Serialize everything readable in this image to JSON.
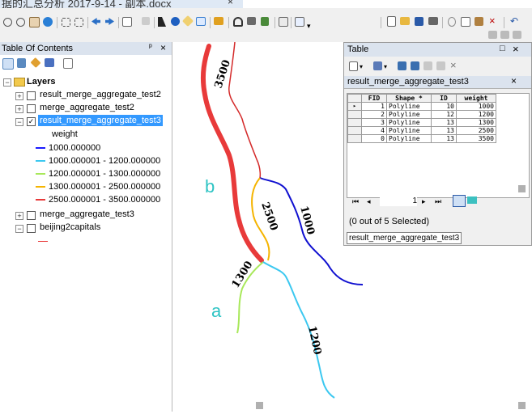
{
  "window": {
    "doc_tab_title": "据的汇总分析 2017-9-14 - 副本.docx",
    "doc_tab_close": "×"
  },
  "toc": {
    "title": "Table Of Contents",
    "pin": "ᵖ",
    "close": "×",
    "root_label": "Layers",
    "layers": [
      {
        "label": "result_merge_aggregate_test2",
        "expanded": false,
        "checked": false
      },
      {
        "label": "merge_aggregate_test2",
        "expanded": false,
        "checked": false
      },
      {
        "label": "result_merge_aggregate_test3",
        "expanded": true,
        "checked": true,
        "selected": true
      },
      {
        "label": "merge_aggregate_test3",
        "expanded": false,
        "checked": false
      },
      {
        "label": "beijing2capitals",
        "expanded": false,
        "checked": false
      }
    ],
    "field_label": "weight",
    "legend": [
      {
        "label": "1000.000000",
        "color": "#1a1aff"
      },
      {
        "label": "1000.000001 - 1200.000000",
        "color": "#3cc8f0"
      },
      {
        "label": "1200.000001 - 1300.000000",
        "color": "#a8e85a"
      },
      {
        "label": "1300.000001 - 2500.000000",
        "color": "#f5b400"
      },
      {
        "label": "2500.000001 - 3500.000000",
        "color": "#e83a3a"
      }
    ],
    "beijing_symbol_color": "#e83a3a"
  },
  "map": {
    "labels": {
      "a": "a",
      "b": "b",
      "v3500": "3500",
      "v2500": "2500",
      "v1000": "1000",
      "v1300": "1300",
      "v1200": "1200"
    },
    "letter_color": "#2ec4c4"
  },
  "table": {
    "window_title": "Table",
    "window_pin": "□",
    "window_close": "×",
    "tab_label": "result_merge_aggregate_test3",
    "tab_close": "×",
    "columns": [
      "",
      "FID",
      "Shape *",
      "ID",
      "weight"
    ],
    "rows": [
      {
        "marker": "▸",
        "fid": "1",
        "shape": "Polyline",
        "id": "10",
        "weight": "1000"
      },
      {
        "marker": "",
        "fid": "2",
        "shape": "Polyline",
        "id": "12",
        "weight": "1200"
      },
      {
        "marker": "",
        "fid": "3",
        "shape": "Polyline",
        "id": "13",
        "weight": "1300"
      },
      {
        "marker": "",
        "fid": "4",
        "shape": "Polyline",
        "id": "13",
        "weight": "2500"
      },
      {
        "marker": "",
        "fid": "0",
        "shape": "Polyline",
        "id": "13",
        "weight": "3500"
      }
    ],
    "nav_first": "⏮",
    "nav_prev": "◂",
    "current_record": "1",
    "nav_next": "▸",
    "nav_last": "⏭",
    "status": "(0 out of 5 Selected)",
    "bottom_tab": "result_merge_aggregate_test3"
  }
}
